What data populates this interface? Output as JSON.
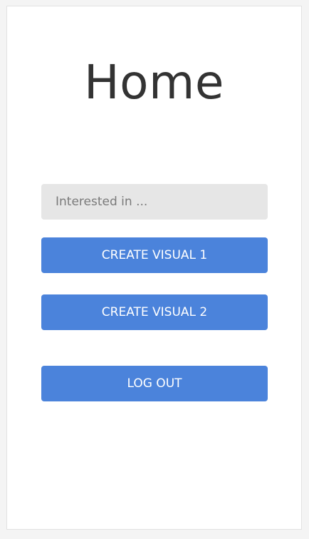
{
  "page": {
    "title": "Home"
  },
  "search": {
    "placeholder": "Interested in ...",
    "value": ""
  },
  "actions": {
    "create_visual_1": "CREATE VISUAL 1",
    "create_visual_2": "CREATE VISUAL 2",
    "log_out": "LOG OUT"
  },
  "colors": {
    "button_bg": "#4b83db",
    "button_text": "#ffffff",
    "input_bg": "#e6e6e6",
    "title_text": "#333333",
    "page_bg": "#f4f4f4",
    "card_bg": "#ffffff"
  }
}
